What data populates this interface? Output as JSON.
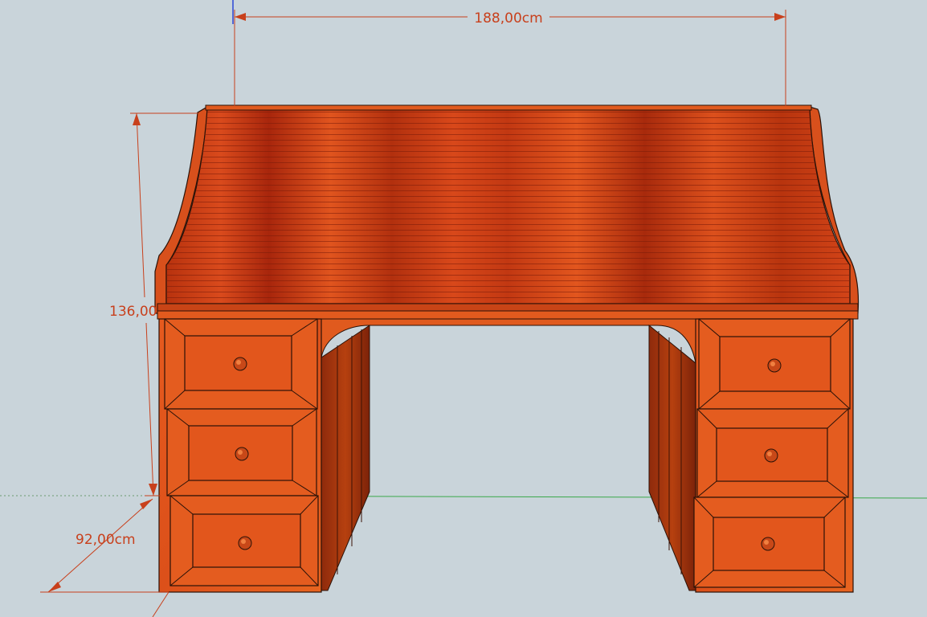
{
  "viewport": {
    "background": "#c9d4da",
    "ground_axis_color": "#3aa84a",
    "blue_axis_color": "#2b46d6"
  },
  "model": {
    "wood_color": "#e0581c",
    "wood_dark": "#8a200c",
    "edge_color": "#2a1208",
    "knob_color": "#c84818"
  },
  "dimensions": {
    "width_label": "188,00cm",
    "height_label": "136,00",
    "depth_label": "92,00cm",
    "color": "#c8401c"
  }
}
